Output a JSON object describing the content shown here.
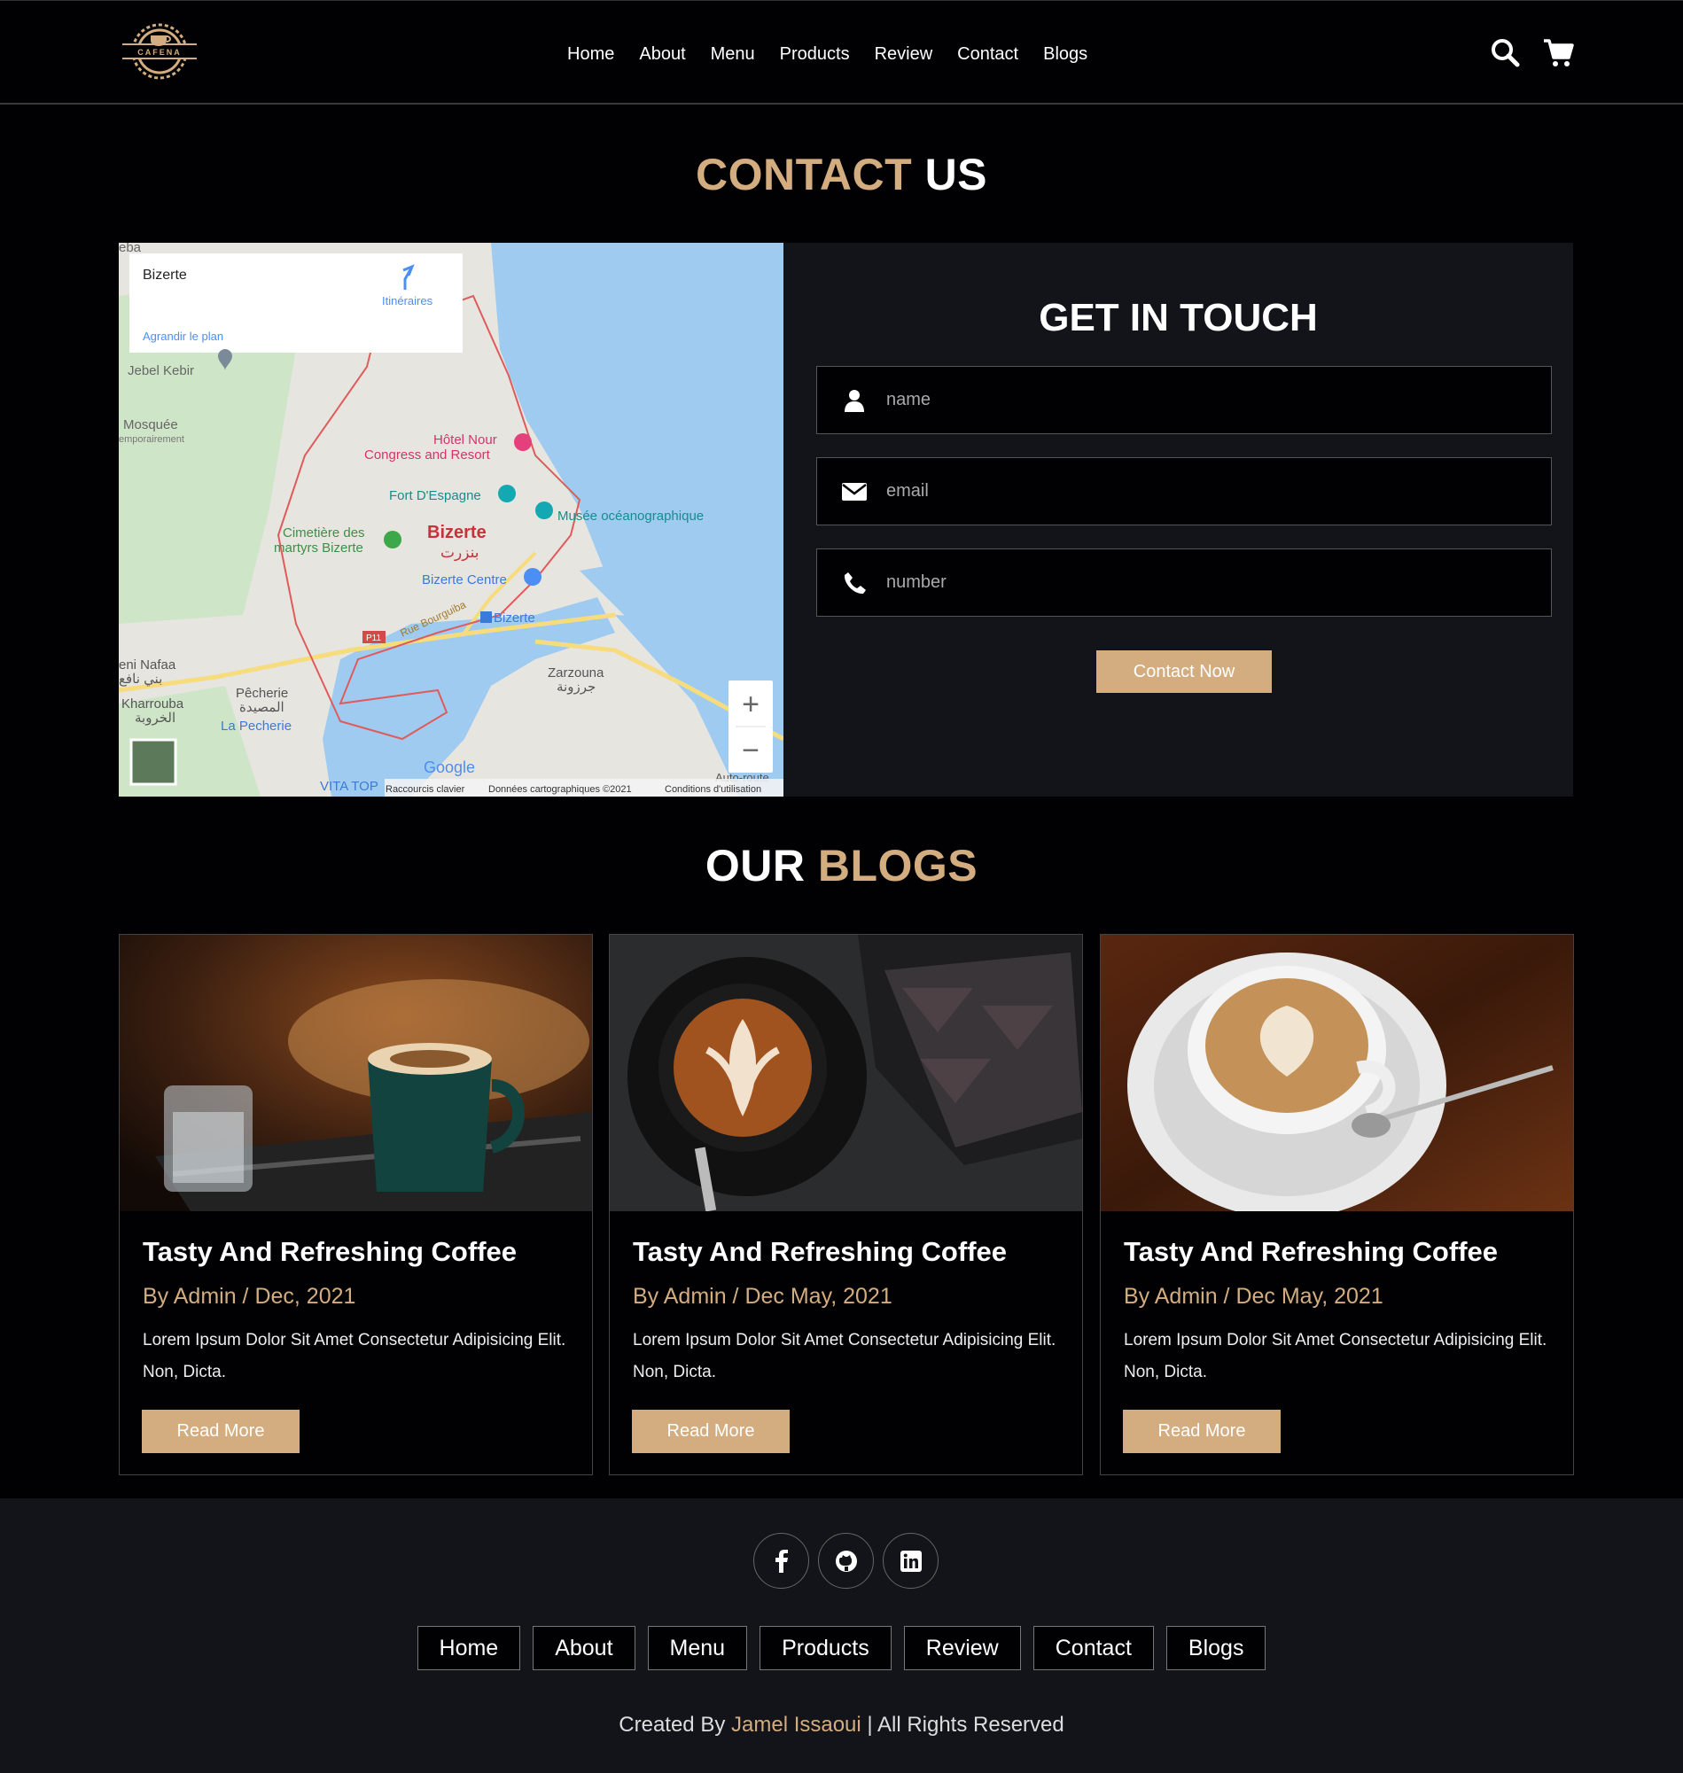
{
  "brand": {
    "name": "CAFENA"
  },
  "nav": [
    "Home",
    "About",
    "Menu",
    "Products",
    "Review",
    "Contact",
    "Blogs"
  ],
  "icons": {
    "search": "search-icon",
    "cart": "cart-icon"
  },
  "contact": {
    "heading_accent": "CONTACT",
    "heading_rest": " US",
    "map": {
      "place_name": "Bizerte",
      "directions_label": "Itinéraires",
      "enlarge_label": "Agrandir le plan",
      "labels": {
        "jebel_kebir": "Jebel Kebir",
        "mosquee": "Mosquée",
        "mosquee_sub": "emporairement",
        "hotel_1": "Hôtel Nour",
        "hotel_2": "Congress and Resort",
        "fort": "Fort D'Espagne",
        "musee": "Musée océanographique",
        "cimetiere_1": "Cimetière des",
        "cimetiere_2": "martyrs Bizerte",
        "city": "Bizerte",
        "city_ar": "بنزرت",
        "centre": "Bizerte Centre",
        "station": "Bizerte",
        "road": "Rue Bourguiba",
        "route": "P11",
        "beni_nafaa": "eni Nafaa",
        "beni_nafaa_ar": "بني نافع",
        "pecherie": "Pêcherie",
        "pecherie_ar": "المصيدة",
        "kharrouba": "Kharrouba",
        "kharrouba_ar": "الخروبة",
        "la_pecherie": "La Pecherie",
        "zarzouna": "Zarzouna",
        "zarzouna_ar": "جرزونة",
        "vita": "VITA TOP",
        "autoroute": "Auto-route",
        "top_cut": "eba"
      },
      "google": "Google",
      "footer_links": [
        "Raccourcis clavier",
        "Données cartographiques ©2021",
        "Conditions d'utilisation"
      ],
      "zoom_in": "+",
      "zoom_out": "−"
    },
    "form": {
      "title": "GET IN TOUCH",
      "name_placeholder": "name",
      "email_placeholder": "email",
      "number_placeholder": "number",
      "submit_label": "Contact Now"
    }
  },
  "blogs": {
    "heading_rest": "OUR ",
    "heading_accent": "BLOGS",
    "items": [
      {
        "title": "Tasty And Refreshing Coffee",
        "meta": "By Admin / Dec, 2021",
        "text": "Lorem Ipsum Dolor Sit Amet Consectetur Adipisicing Elit. Non, Dicta.",
        "button": "Read More"
      },
      {
        "title": "Tasty And Refreshing Coffee",
        "meta": "By Admin / Dec May, 2021",
        "text": "Lorem Ipsum Dolor Sit Amet Consectetur Adipisicing Elit. Non, Dicta.",
        "button": "Read More"
      },
      {
        "title": "Tasty And Refreshing Coffee",
        "meta": "By Admin / Dec May, 2021",
        "text": "Lorem Ipsum Dolor Sit Amet Consectetur Adipisicing Elit. Non, Dicta.",
        "button": "Read More"
      }
    ]
  },
  "footer": {
    "socials": [
      "facebook-icon",
      "github-icon",
      "linkedin-icon"
    ],
    "links": [
      "Home",
      "About",
      "Menu",
      "Products",
      "Review",
      "Contact",
      "Blogs"
    ],
    "credit_prefix": "Created By ",
    "credit_name": "Jamel Issaoui",
    "credit_suffix": " | All Rights Reserved"
  },
  "colors": {
    "accent": "#d3ad7f",
    "background": "#010103",
    "panel": "#13131a"
  }
}
